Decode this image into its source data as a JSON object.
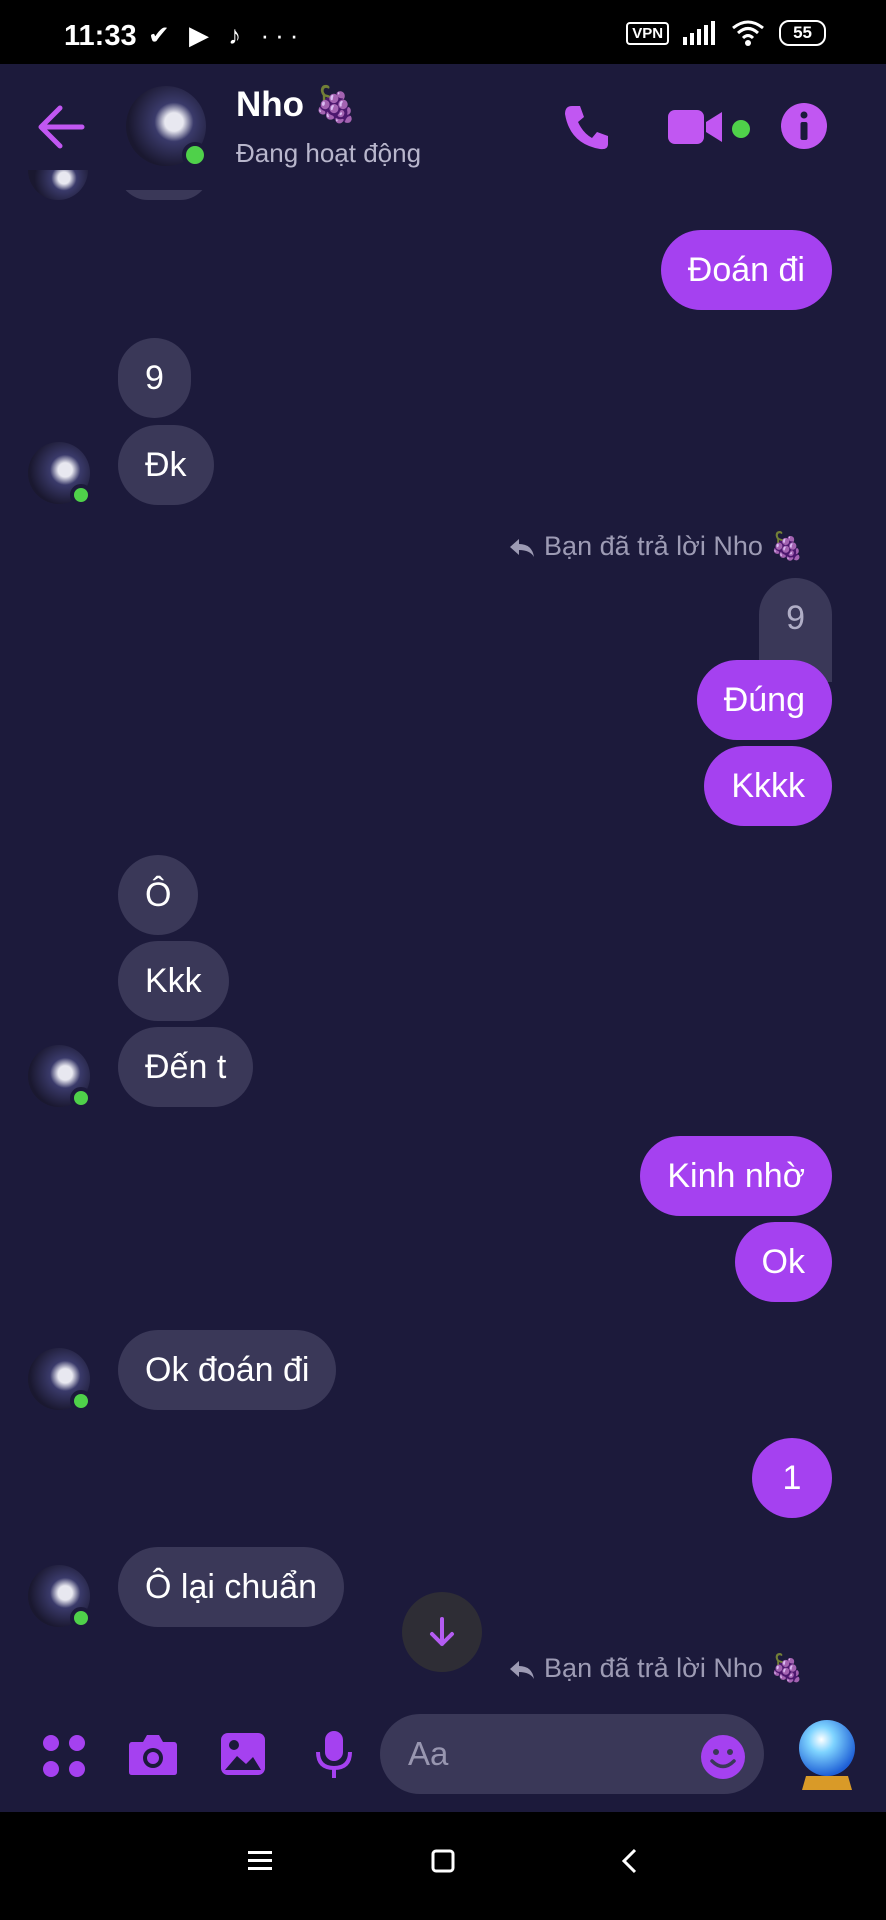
{
  "status_bar": {
    "time": "11:33",
    "notification_icons": "✔ ▶ ♪ ···",
    "vpn": "VPN",
    "battery": "55"
  },
  "header": {
    "name": "Nho 🍇",
    "status": "Đang hoạt động",
    "accent": "#c157f2",
    "online_color": "#4fd14a"
  },
  "messages": {
    "m1": "Đoán đi",
    "m2": "9",
    "m3": "Đk",
    "reply_note_1": "Bạn đã trả lời Nho 🍇",
    "quoted": "9",
    "m4": "Đúng",
    "m5": "Kkkk",
    "m6": "Ô",
    "m7": "Kkk",
    "m8": "Đến t",
    "m9": "Kinh nhờ",
    "m10": "Ok",
    "m11": "Ok đoán đi",
    "m12": "1",
    "m13": "Ô lại chuẩn",
    "reply_note_2": "Bạn đã trả lời Nho 🍇"
  },
  "composer": {
    "placeholder": "Aa"
  },
  "colors": {
    "background": "#1c1a3b",
    "bubble_me": "#a541f0",
    "bubble_other": "#3a3858"
  }
}
